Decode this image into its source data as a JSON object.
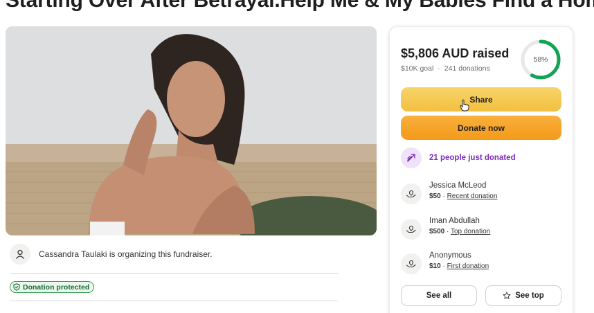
{
  "page_title": "Starting Over After Betrayal.Help Me & My Babies Find a Home",
  "organizer": {
    "text": "Cassandra Taulaki is organizing this fundraiser.",
    "icon": "person-icon"
  },
  "protected_badge": "Donation protected",
  "card": {
    "raised": "$5,806 AUD raised",
    "goal": "$10K goal",
    "separator": "·",
    "donations": "241 donations",
    "progress_label": "58%",
    "progress_fraction": 0.58,
    "share_label": "Share",
    "donate_label": "Donate now",
    "trend_text": "21 people just donated",
    "donors": [
      {
        "name": "Jessica McLeod",
        "amount": "$50",
        "sep": " · ",
        "tag": "Recent donation"
      },
      {
        "name": "Iman Abdullah",
        "amount": "$500",
        "sep": " · ",
        "tag": "Top donation"
      },
      {
        "name": "Anonymous",
        "amount": "$10",
        "sep": " · ",
        "tag": "First donation"
      }
    ],
    "see_all_label": "See all",
    "see_top_label": "See top"
  },
  "colors": {
    "progress": "#12a454",
    "share_button": "#f5c84f",
    "donate_button": "#f6a52b",
    "trend_text": "#7a2bbd",
    "badge_border": "#3aa057"
  }
}
